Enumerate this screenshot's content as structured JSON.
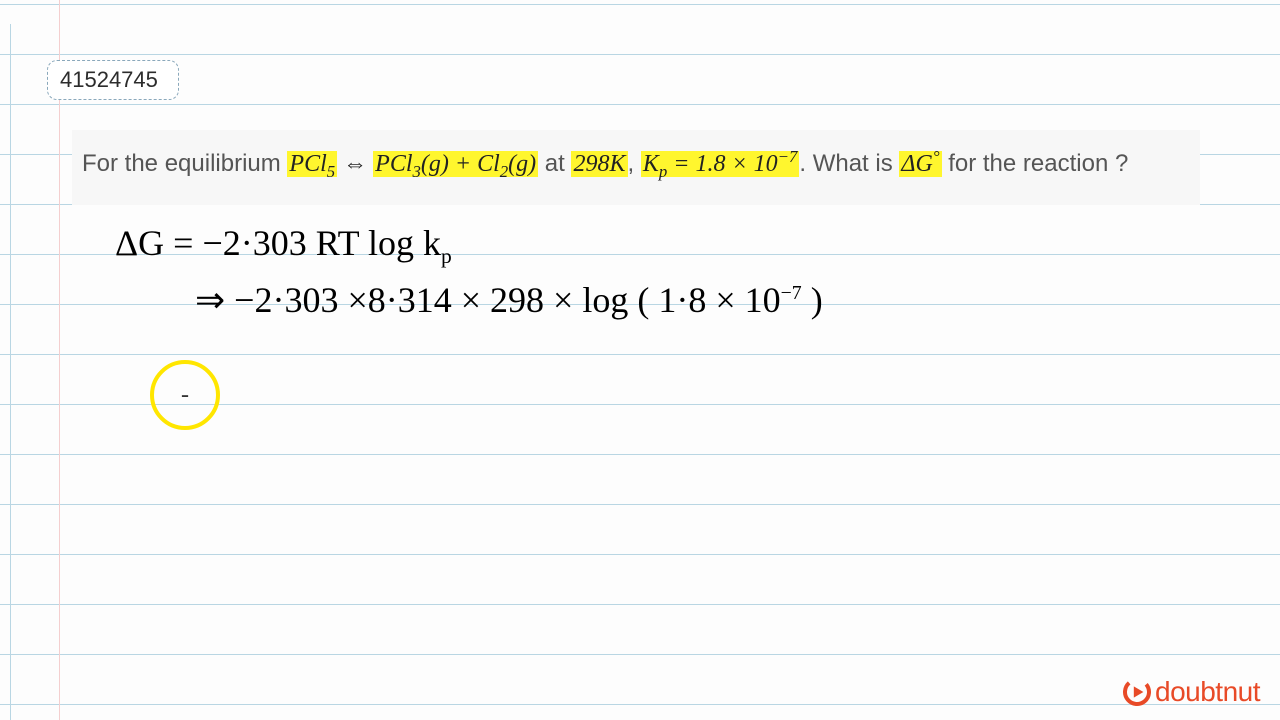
{
  "id": "41524745",
  "question": {
    "p1": "For the equilibrium ",
    "eq1": "PCl",
    "eq1sub": "5",
    "arr": " ⇔ ",
    "eq2": "PCl",
    "eq2sub": "3",
    "eq2g": "(g) + Cl",
    "eq2sub2": "2",
    "eq2g2": "(g)",
    "p2": " at ",
    "temp": "298K",
    "p3": ", ",
    "kp": "K",
    "kpsub": "p",
    "kpval": " = 1.8 × 10",
    "kpexp": "−7",
    "p4": ". What is ",
    "dg": "ΔG",
    "dgsup": "°",
    "p5": " for the reaction ?"
  },
  "hand": {
    "l1a": "ΔG",
    "l1b": " =   −2·303  RT  ",
    "l1log": "log",
    "l1c": "  k",
    "l1sub": "p",
    "l2a": "⇒   −2·303 ×8·314 × 298   ×  ",
    "l2log": "log",
    "l2b": " ( 1·8 × 10",
    "l2exp": "−7",
    "l2c": " )"
  },
  "circle": "-",
  "brand": "doubtnut"
}
